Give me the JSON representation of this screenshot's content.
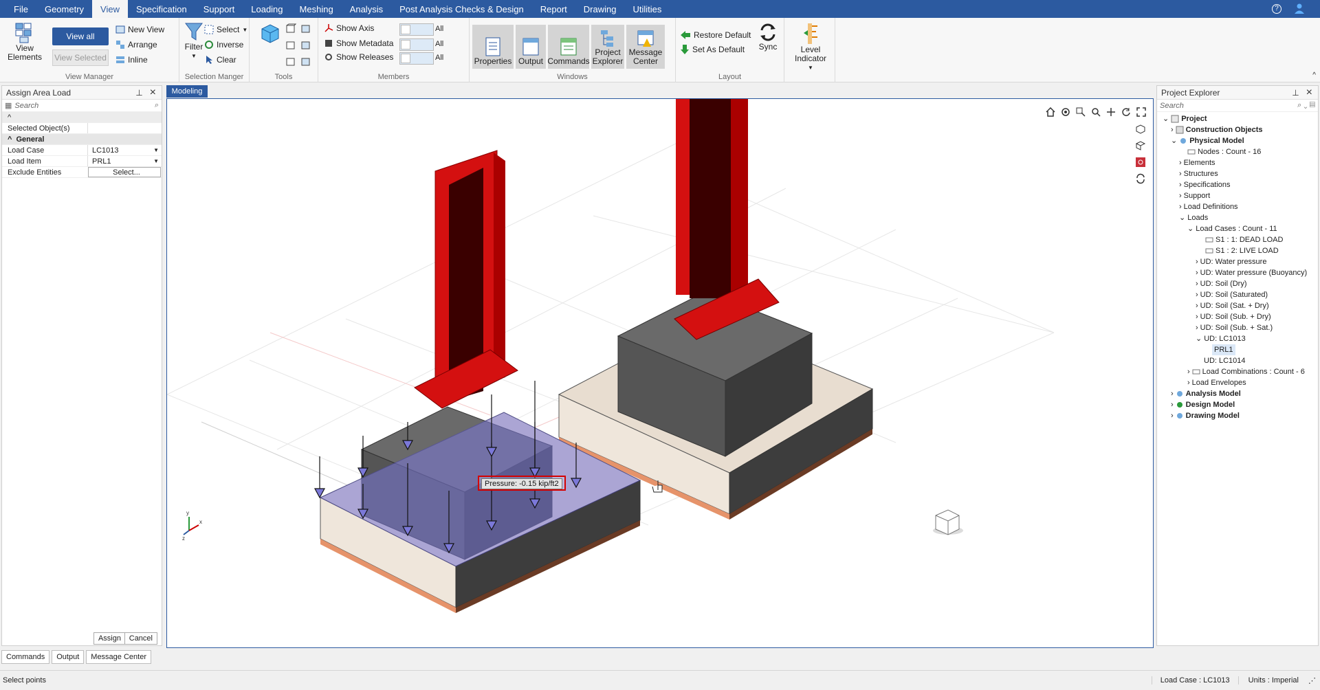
{
  "menu": {
    "items": [
      "File",
      "Geometry",
      "View",
      "Specification",
      "Support",
      "Loading",
      "Meshing",
      "Analysis",
      "Post Analysis Checks & Design",
      "Report",
      "Drawing",
      "Utilities"
    ]
  },
  "ribbon": {
    "view_manager": {
      "view_elements": "View Elements",
      "view_all": "View all",
      "view_selected": "View Selected",
      "new_view": "New View",
      "arrange": "Arrange",
      "inline": "Inline",
      "label": "View Manager"
    },
    "selection": {
      "filter": "Filter",
      "select": "Select",
      "inverse": "Inverse",
      "clear": "Clear",
      "label": "Selection Manger"
    },
    "tools": {
      "label": "Tools"
    },
    "members": {
      "show_axis": "Show Axis",
      "show_metadata": "Show Metadata",
      "show_releases": "Show Releases",
      "all": "All",
      "label": "Members"
    },
    "windows": {
      "properties": "Properties",
      "output": "Output",
      "commands": "Commands",
      "project_explorer": "Project Explorer",
      "message_center": "Message Center",
      "label": "Windows"
    },
    "layout": {
      "restore_default": "Restore Default",
      "set_as_default": "Set As Default",
      "sync": "Sync",
      "label": "Layout"
    },
    "level_indicator": "Level Indicator"
  },
  "left_panel": {
    "title": "Assign Area Load",
    "search_placeholder": "Search",
    "selected_objects": "Selected Object(s)",
    "general": "General",
    "load_case_label": "Load Case",
    "load_case_value": "LC1013",
    "load_item_label": "Load Item",
    "load_item_value": "PRL1",
    "exclude_label": "Exclude Entities",
    "exclude_value": "Select...",
    "assign": "Assign",
    "cancel": "Cancel"
  },
  "canvas": {
    "tab": "Modeling",
    "tooltip": "Pressure: -0.15 kip/ft2"
  },
  "project_explorer": {
    "title": "Project Explorer",
    "search_placeholder": "Search",
    "nodes": [
      {
        "label": "Project",
        "bold": true
      },
      {
        "label": "Construction Objects",
        "bold": true
      },
      {
        "label": "Physical Model",
        "bold": true
      },
      {
        "label": "Nodes : Count - 16"
      },
      {
        "label": "Elements"
      },
      {
        "label": "Structures"
      },
      {
        "label": "Specifications"
      },
      {
        "label": "Support"
      },
      {
        "label": "Load Definitions"
      },
      {
        "label": "Loads"
      },
      {
        "label": "Load Cases : Count - 11"
      },
      {
        "label": "S1 : 1: DEAD LOAD"
      },
      {
        "label": "S1 : 2: LIVE LOAD"
      },
      {
        "label": "UD: Water pressure"
      },
      {
        "label": "UD: Water pressure (Buoyancy)"
      },
      {
        "label": "UD: Soil (Dry)"
      },
      {
        "label": "UD: Soil (Saturated)"
      },
      {
        "label": "UD: Soil (Sat. + Dry)"
      },
      {
        "label": "UD: Soil (Sub. + Dry)"
      },
      {
        "label": "UD: Soil (Sub. + Sat.)"
      },
      {
        "label": "UD: LC1013"
      },
      {
        "label": "PRL1"
      },
      {
        "label": "UD: LC1014"
      },
      {
        "label": "Load Combinations : Count - 6"
      },
      {
        "label": "Load Envelopes"
      },
      {
        "label": "Analysis Model",
        "bold": true
      },
      {
        "label": "Design Model",
        "bold": true
      },
      {
        "label": "Drawing Model",
        "bold": true
      }
    ]
  },
  "bottom_tabs": [
    "Commands",
    "Output",
    "Message Center"
  ],
  "status": {
    "left": "Select points",
    "load_case": "Load Case : LC1013",
    "units": "Units : Imperial"
  },
  "colors": {
    "accent": "#2c5aa0",
    "column": "#d41010",
    "pedestal": "#4a4a4a",
    "slab": "#e8ddd0",
    "pressure": "#7b78d8"
  }
}
